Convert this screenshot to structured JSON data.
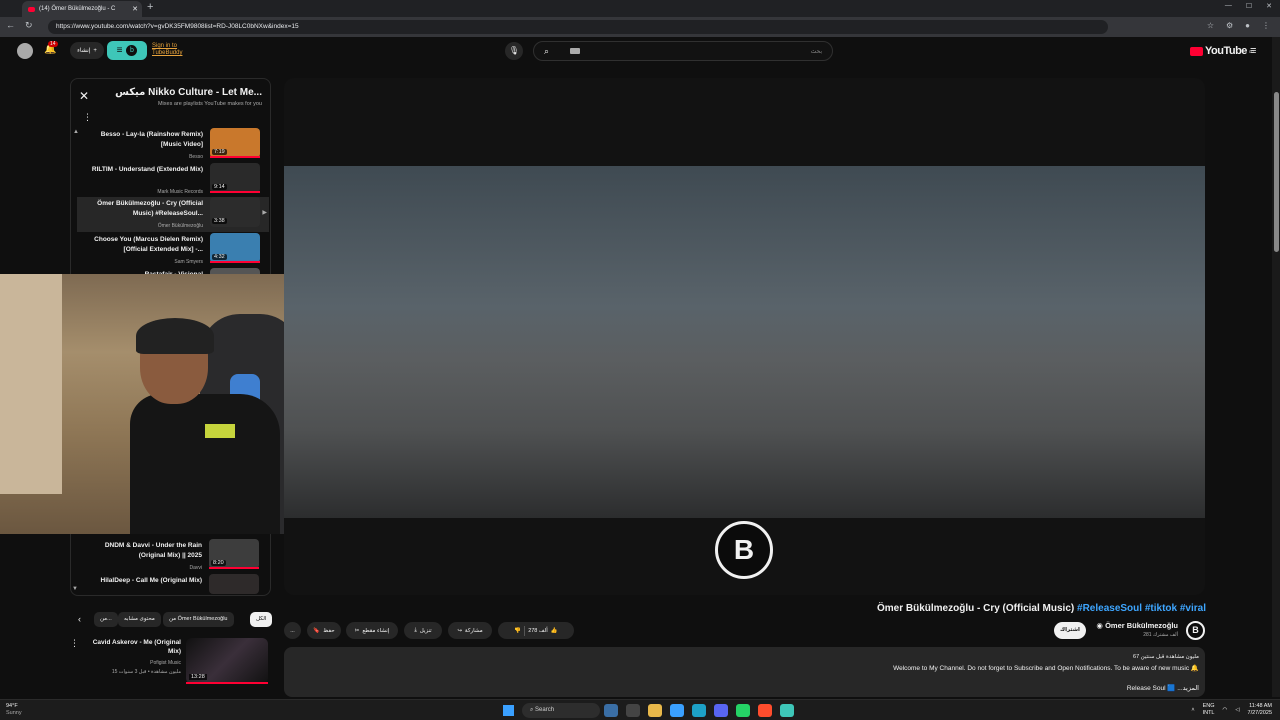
{
  "browser": {
    "tab_title": "(14) Ömer Bükülmezoğlu - C",
    "tab_close": "✕",
    "new_tab": "+",
    "window_controls": [
      "—",
      "☐",
      "✕"
    ],
    "url": "https://www.youtube.com/watch?v=gvDK35FM9808list=RD-J08LC0bNXw&index=15"
  },
  "header": {
    "notification_count": "14",
    "create_label": "إنشاء",
    "extension_link": "Sign in to TubeBuddy",
    "search_placeholder": "بحث",
    "logo_text": "YouTube",
    "logo_region": "EG"
  },
  "playlist": {
    "title": "ميكس Nikko Culture - Let Me...",
    "subtitle": "Mixes are playlists YouTube makes for you",
    "items": [
      {
        "title": "Besso - Lay-la (Rainshow Remix) [Music Video]",
        "channel": "Besso",
        "duration": "7:19",
        "progress": 1.0,
        "thumb_color": "#c9782c"
      },
      {
        "title": "RILTIM - Understand (Extended Mix)",
        "channel": "Mark Music Records",
        "duration": "9:14",
        "progress": 1.0,
        "thumb_color": "#2a2a2a"
      },
      {
        "title": "Ömer Bükülmezoğlu - Cry (Official Music) #ReleaseSoul...",
        "channel": "Ömer Bükülmezoğlu",
        "duration": "3:38",
        "progress": 0.0,
        "thumb_color": "#2c2c2c"
      },
      {
        "title": "Choose You (Marcus Dielen Remix) [Official Extended Mix] -...",
        "channel": "Sam Smyers",
        "duration": "4:32",
        "progress": 1.0,
        "thumb_color": "#3a7fb0"
      },
      {
        "title": "Rastafair - Visional",
        "channel": "",
        "duration": "",
        "progress": 0.0,
        "thumb_color": "#555555"
      }
    ],
    "lower_items": [
      {
        "title": "DNDM & Davvi - Under the Rain (Original Mix) || 2025",
        "channel": "Davvi",
        "duration": "8:20",
        "progress": 1.0,
        "thumb_color": "#3d3d3d"
      },
      {
        "title": "HilalDeep - Call Me (Original Mix)",
        "channel": "",
        "duration": "",
        "progress": 0.0,
        "thumb_color": "#2e2a2a"
      }
    ]
  },
  "chips": {
    "all": "الكل",
    "from_channel": "من Ömer Bükülmezoğlu",
    "similar": "محتوى مشابه",
    "more": "من..."
  },
  "recommendation": {
    "title": "Cavid Askerov - Me (Original Mix)",
    "channel": "Pofigist Music",
    "views": "15 مليون مشاهدة • قبل 3 سنوات",
    "duration": "13:28"
  },
  "video": {
    "logo_letter": "B",
    "title_main": "Ömer Bükülmezoğlu - Cry (Official Music)",
    "tags": [
      "#ReleaseSoul",
      "#tiktok",
      "#viral"
    ]
  },
  "actions": {
    "more": "...",
    "save": "حفظ",
    "clip": "إنشاء مقطع",
    "download": "تنزيل",
    "share": "مشاركة",
    "likes": "278 ألف"
  },
  "channel": {
    "name": "Ömer Bükülmezoğlu",
    "subscribers": "281 ألف مشترك",
    "subscribe": "اشتراك",
    "avatar_letter": "B"
  },
  "description": {
    "stats": "67 مليون مشاهدة  قبل سنتين",
    "line1": "Welcome to My Channel. Do not forget to Subscribe and Open Notifications. To be aware of new music 🔔",
    "line2": "Release Soul 🟦 ...المزيد"
  },
  "taskbar": {
    "temp": "94°F",
    "weather": "Sunny",
    "search": "Search",
    "lang": "ENG",
    "lang_sub": "INTL",
    "time": "11:48 AM",
    "date": "7/27/2025",
    "app_colors": [
      "#3a6ea5",
      "#444444",
      "#e8b84a",
      "#3aa0ff",
      "#1da1c7",
      "#5865f2",
      "#25d366",
      "#ff4d2d",
      "#3ec6b8"
    ]
  }
}
